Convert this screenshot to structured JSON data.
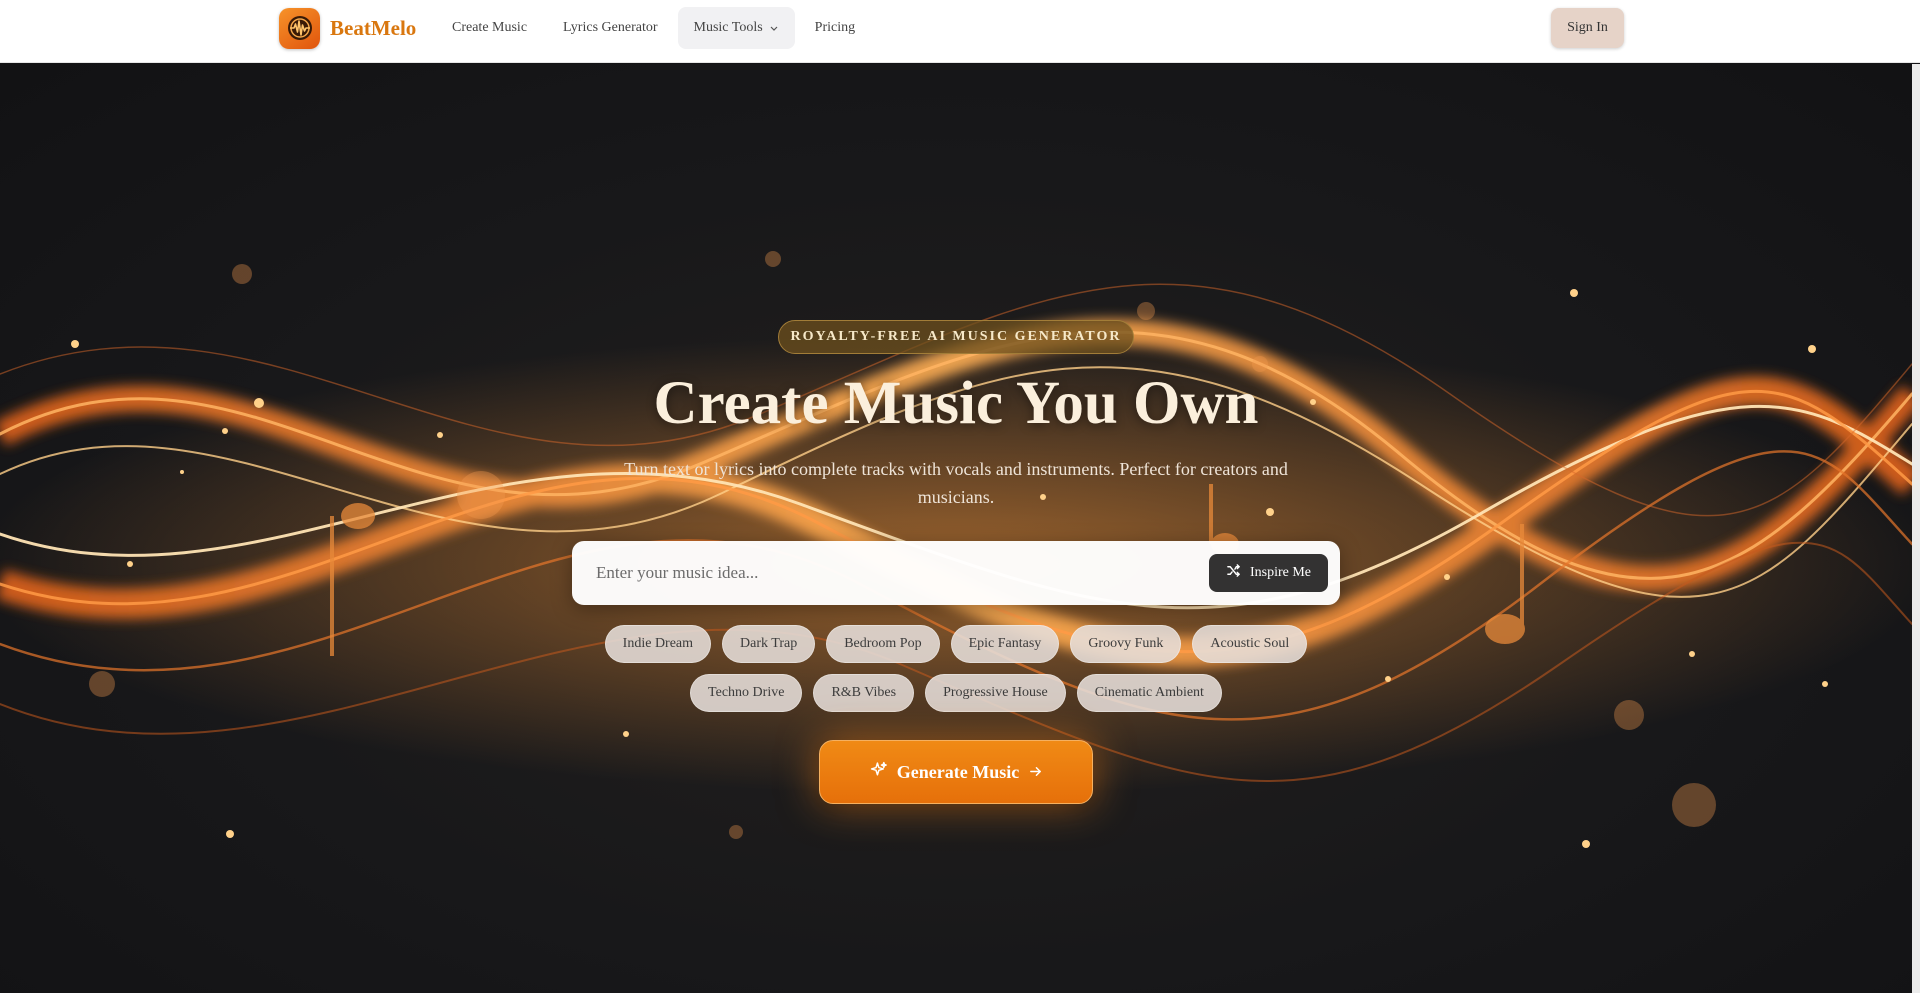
{
  "nav": {
    "brand": "BeatMelo",
    "links": [
      "Create Music",
      "Lyrics Generator",
      "Music Tools",
      "Pricing"
    ],
    "sign_in": "Sign In"
  },
  "hero": {
    "badge": "ROYALTY-FREE AI MUSIC GENERATOR",
    "title": "Create Music You Own",
    "subtitle": "Turn text or lyrics into complete tracks with vocals and instruments. Perfect for creators and musicians.",
    "search_placeholder": "Enter your music idea...",
    "inspire_label": "Inspire Me",
    "tags": [
      "Indie Dream",
      "Dark Trap",
      "Bedroom Pop",
      "Epic Fantasy",
      "Groovy Funk",
      "Acoustic Soul",
      "Techno Drive",
      "R&B Vibes",
      "Progressive House",
      "Cinematic Ambient"
    ],
    "generate_label": "Generate Music"
  },
  "colors": {
    "accent": "#e6700a",
    "brand": "#d9770f",
    "background": "#141416"
  }
}
